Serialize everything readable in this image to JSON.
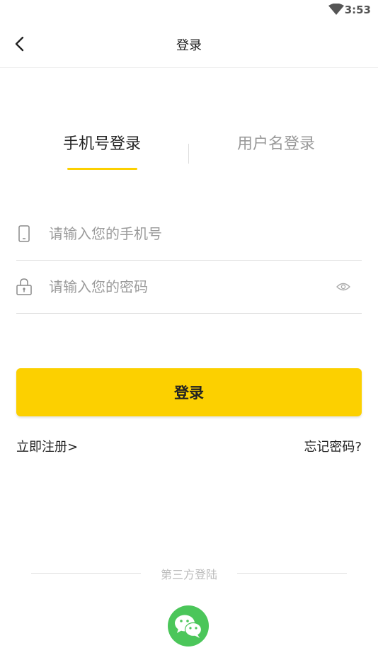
{
  "status_bar": {
    "time": "3:53"
  },
  "app_bar": {
    "title": "登录"
  },
  "tabs": [
    {
      "label": "手机号登录",
      "active": true
    },
    {
      "label": "用户名登录",
      "active": false
    }
  ],
  "form": {
    "phone": {
      "placeholder": "请输入您的手机号",
      "value": ""
    },
    "password": {
      "placeholder": "请输入您的密码",
      "value": ""
    },
    "login_label": "登录"
  },
  "links": {
    "register": "立即注册>",
    "forgot": "忘记密码?"
  },
  "third_party": {
    "label": "第三方登陆",
    "providers": [
      "wechat-icon"
    ]
  },
  "colors": {
    "accent": "#fcd000",
    "wechat": "#4bc65a"
  }
}
